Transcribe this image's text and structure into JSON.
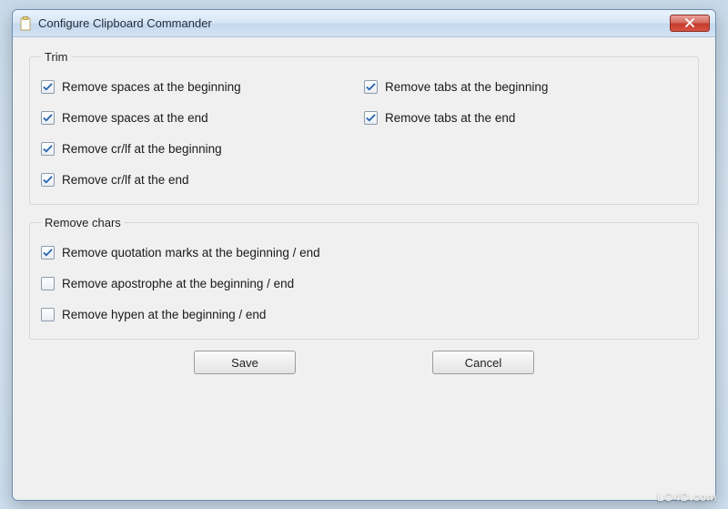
{
  "window": {
    "title": "Configure Clipboard Commander"
  },
  "groups": {
    "trim": {
      "legend": "Trim",
      "left": [
        {
          "label": "Remove spaces at the beginning",
          "checked": true
        },
        {
          "label": "Remove spaces at the end",
          "checked": true
        },
        {
          "label": "Remove cr/lf at the beginning",
          "checked": true
        },
        {
          "label": "Remove cr/lf at the end",
          "checked": true
        }
      ],
      "right": [
        {
          "label": "Remove tabs at the beginning",
          "checked": true
        },
        {
          "label": "Remove tabs at the end",
          "checked": true
        }
      ]
    },
    "remove_chars": {
      "legend": "Remove chars",
      "items": [
        {
          "label": "Remove quotation marks at the beginning / end",
          "checked": true
        },
        {
          "label": "Remove apostrophe at the beginning / end",
          "checked": false
        },
        {
          "label": "Remove hypen at the beginning / end",
          "checked": false
        }
      ]
    }
  },
  "buttons": {
    "save": "Save",
    "cancel": "Cancel"
  },
  "watermark": "LO4D.com"
}
